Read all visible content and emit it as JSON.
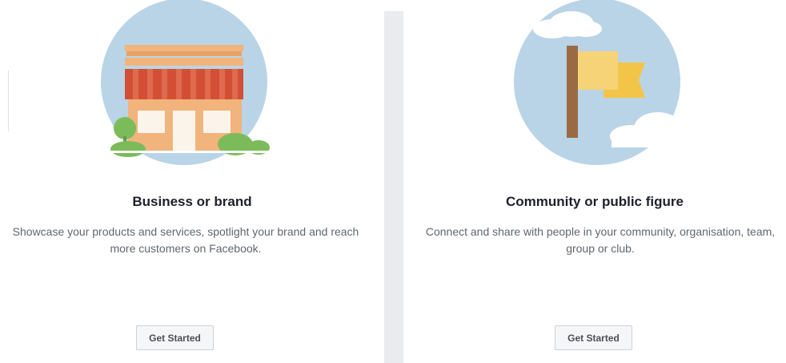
{
  "cards": [
    {
      "title": "Business or brand",
      "description": "Showcase your products and services, spotlight your brand and reach more customers on Facebook.",
      "button_label": "Get Started",
      "icon": "storefront-illustration"
    },
    {
      "title": "Community or public figure",
      "description": "Connect and share with people in your community, organisation, team, group or club.",
      "button_label": "Get Started",
      "icon": "flag-illustration"
    }
  ],
  "colors": {
    "illustration_circle": "#b9d4e6",
    "awning_red": "#d24f35",
    "building_peach": "#f1b47c",
    "tree_green": "#7cbb5a",
    "flag_yellow": "#f6d377",
    "flagpole_brown": "#9a6b43",
    "divider": "#e9ebee"
  }
}
